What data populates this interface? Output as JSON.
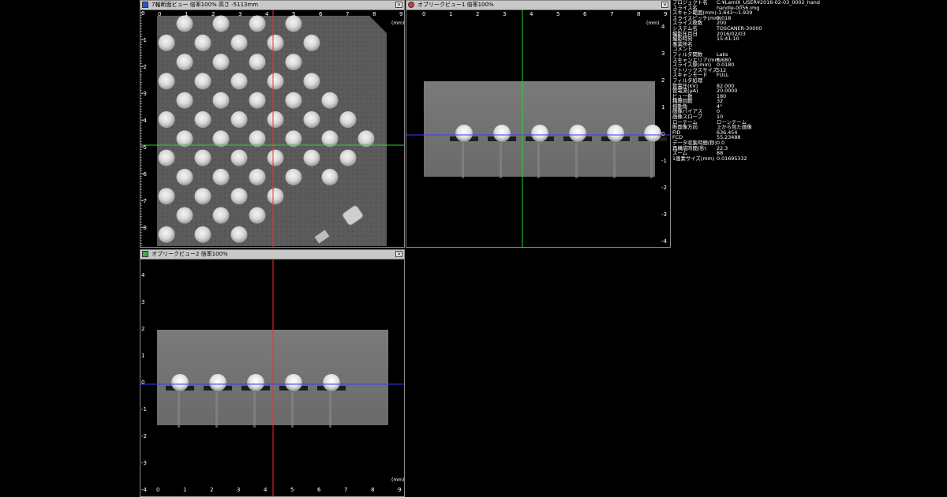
{
  "axial_view": {
    "title": "7軸断面ビュー 倍率100% 高さ -5113mm",
    "close_label": "×",
    "x_ticks": [
      "0",
      "1",
      "2",
      "3",
      "4",
      "5",
      "6",
      "7",
      "8",
      "9"
    ],
    "y_ticks": [
      "0",
      "-1",
      "-2",
      "-3",
      "-4",
      "-5",
      "-6",
      "-7",
      "-8"
    ],
    "unit": "(mm)"
  },
  "oblique_view_1": {
    "title": "オブリークビュー1 倍率100%",
    "close_label": "×",
    "x_ticks": [
      "0",
      "1",
      "2",
      "3",
      "4",
      "5",
      "6",
      "7",
      "8",
      "9"
    ],
    "y_ticks": [
      "4",
      "3",
      "2",
      "1",
      "0",
      "-1",
      "-2",
      "-3",
      "-4"
    ],
    "unit": "(mm)"
  },
  "oblique_view_2": {
    "title": "オブリークビュー2 倍率100%",
    "close_label": "×",
    "x_ticks": [
      "0",
      "1",
      "2",
      "3",
      "4",
      "5",
      "6",
      "7",
      "8",
      "9"
    ],
    "y_ticks": [
      "4",
      "3",
      "2",
      "1",
      "0",
      "-1",
      "-2",
      "-3",
      "-4"
    ],
    "unit": "(mm)"
  },
  "info_panel": [
    {
      "key": "プロジェクト名",
      "value": "C:¥LamiX_USER¥2016-02-03_0002_hand"
    },
    {
      "key": "スライス名",
      "value": "handle-0056.img"
    },
    {
      "key": "スキャン範囲(mm)",
      "value": "-1.643～1.939"
    },
    {
      "key": "スライスピッチ(mm)",
      "value": "0.018"
    },
    {
      "key": "スライス枚数",
      "value": "200"
    },
    {
      "key": "システム名",
      "value": "TOSCANER-30000"
    },
    {
      "key": "撮影年月日",
      "value": "2016/02/03"
    },
    {
      "key": "撮影時刻",
      "value": "15:41:10"
    },
    {
      "key": "事業所名",
      "value": ""
    },
    {
      "key": "コメント",
      "value": ""
    },
    {
      "key": "フィルタ関数",
      "value": "Laks"
    },
    {
      "key": "スキャンエリア(mm)",
      "value": "8.680"
    },
    {
      "key": "スライス厚(mm)",
      "value": "0.0180"
    },
    {
      "key": "マトリックスサイズ",
      "value": "512"
    },
    {
      "key": "スキャンモード",
      "value": "FULL"
    },
    {
      "key": "フィルタ処理",
      "value": ""
    },
    {
      "key": "管電圧(kV)",
      "value": "82.000"
    },
    {
      "key": "管電流(μA)",
      "value": "20.0000"
    },
    {
      "key": "ビュー数",
      "value": "180"
    },
    {
      "key": "積算回数",
      "value": "32"
    },
    {
      "key": "揺動角",
      "value": "4°"
    },
    {
      "key": "画像バイアス",
      "value": "0"
    },
    {
      "key": "画像スロープ",
      "value": "10"
    },
    {
      "key": "ローテーム",
      "value": "ローンテーム"
    },
    {
      "key": "断面像方向",
      "value": "上から見た画像"
    },
    {
      "key": "FID",
      "value": "636.454"
    },
    {
      "key": "FCD",
      "value": "55.23488"
    },
    {
      "key": "データ収集時間(秒)",
      "value": "0.0"
    },
    {
      "key": "再構成時間(秒)",
      "value": "22.3"
    },
    {
      "key": "ズーム",
      "value": "88"
    },
    {
      "key": "1画素サイズ(mm)",
      "value": "0.01695332"
    }
  ]
}
